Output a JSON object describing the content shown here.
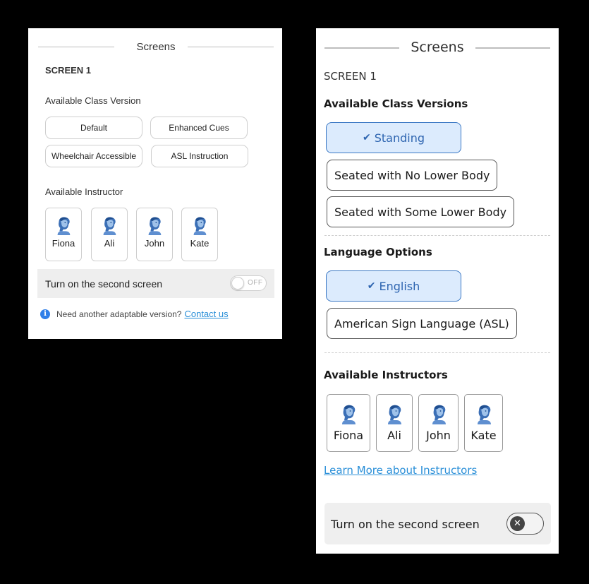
{
  "left_panel": {
    "title": "Screens",
    "screen_label": "SCREEN 1",
    "class_version_heading": "Available Class Version",
    "class_versions": [
      "Default",
      "Enhanced Cues",
      "Wheelchair Accessible",
      "ASL Instruction"
    ],
    "instructor_heading": "Available Instructor",
    "instructors": [
      "Fiona",
      "Ali",
      "John",
      "Kate"
    ],
    "second_screen_label": "Turn on the second screen",
    "toggle_state": "OFF",
    "info_text": "Need another adaptable version?",
    "contact_link": "Contact us",
    "info_icon": "i"
  },
  "right_panel": {
    "title": "Screens",
    "screen_label": "SCREEN 1",
    "class_versions_heading": "Available Class Versions",
    "class_versions": [
      {
        "label": "Standing",
        "selected": true
      },
      {
        "label": "Seated with No Lower Body",
        "selected": false
      },
      {
        "label": "Seated with Some Lower Body",
        "selected": false
      }
    ],
    "language_heading": "Language Options",
    "languages": [
      {
        "label": "English",
        "selected": true
      },
      {
        "label": "American Sign Language (ASL)",
        "selected": false
      }
    ],
    "instructors_heading": "Available Instructors",
    "instructors": [
      "Fiona",
      "Ali",
      "John",
      "Kate"
    ],
    "learn_more_link": "Learn More about Instructors",
    "second_screen_label": "Turn on the second screen",
    "toggle_on": false
  },
  "colors": {
    "selected_bg": "#dcebfd",
    "selected_border": "#3b78c4",
    "link": "#2a8fd8",
    "avatar_blue": "#3b6fb6"
  },
  "icons": [
    "avatar-icon",
    "info-icon",
    "checkmark-icon",
    "close-icon"
  ]
}
